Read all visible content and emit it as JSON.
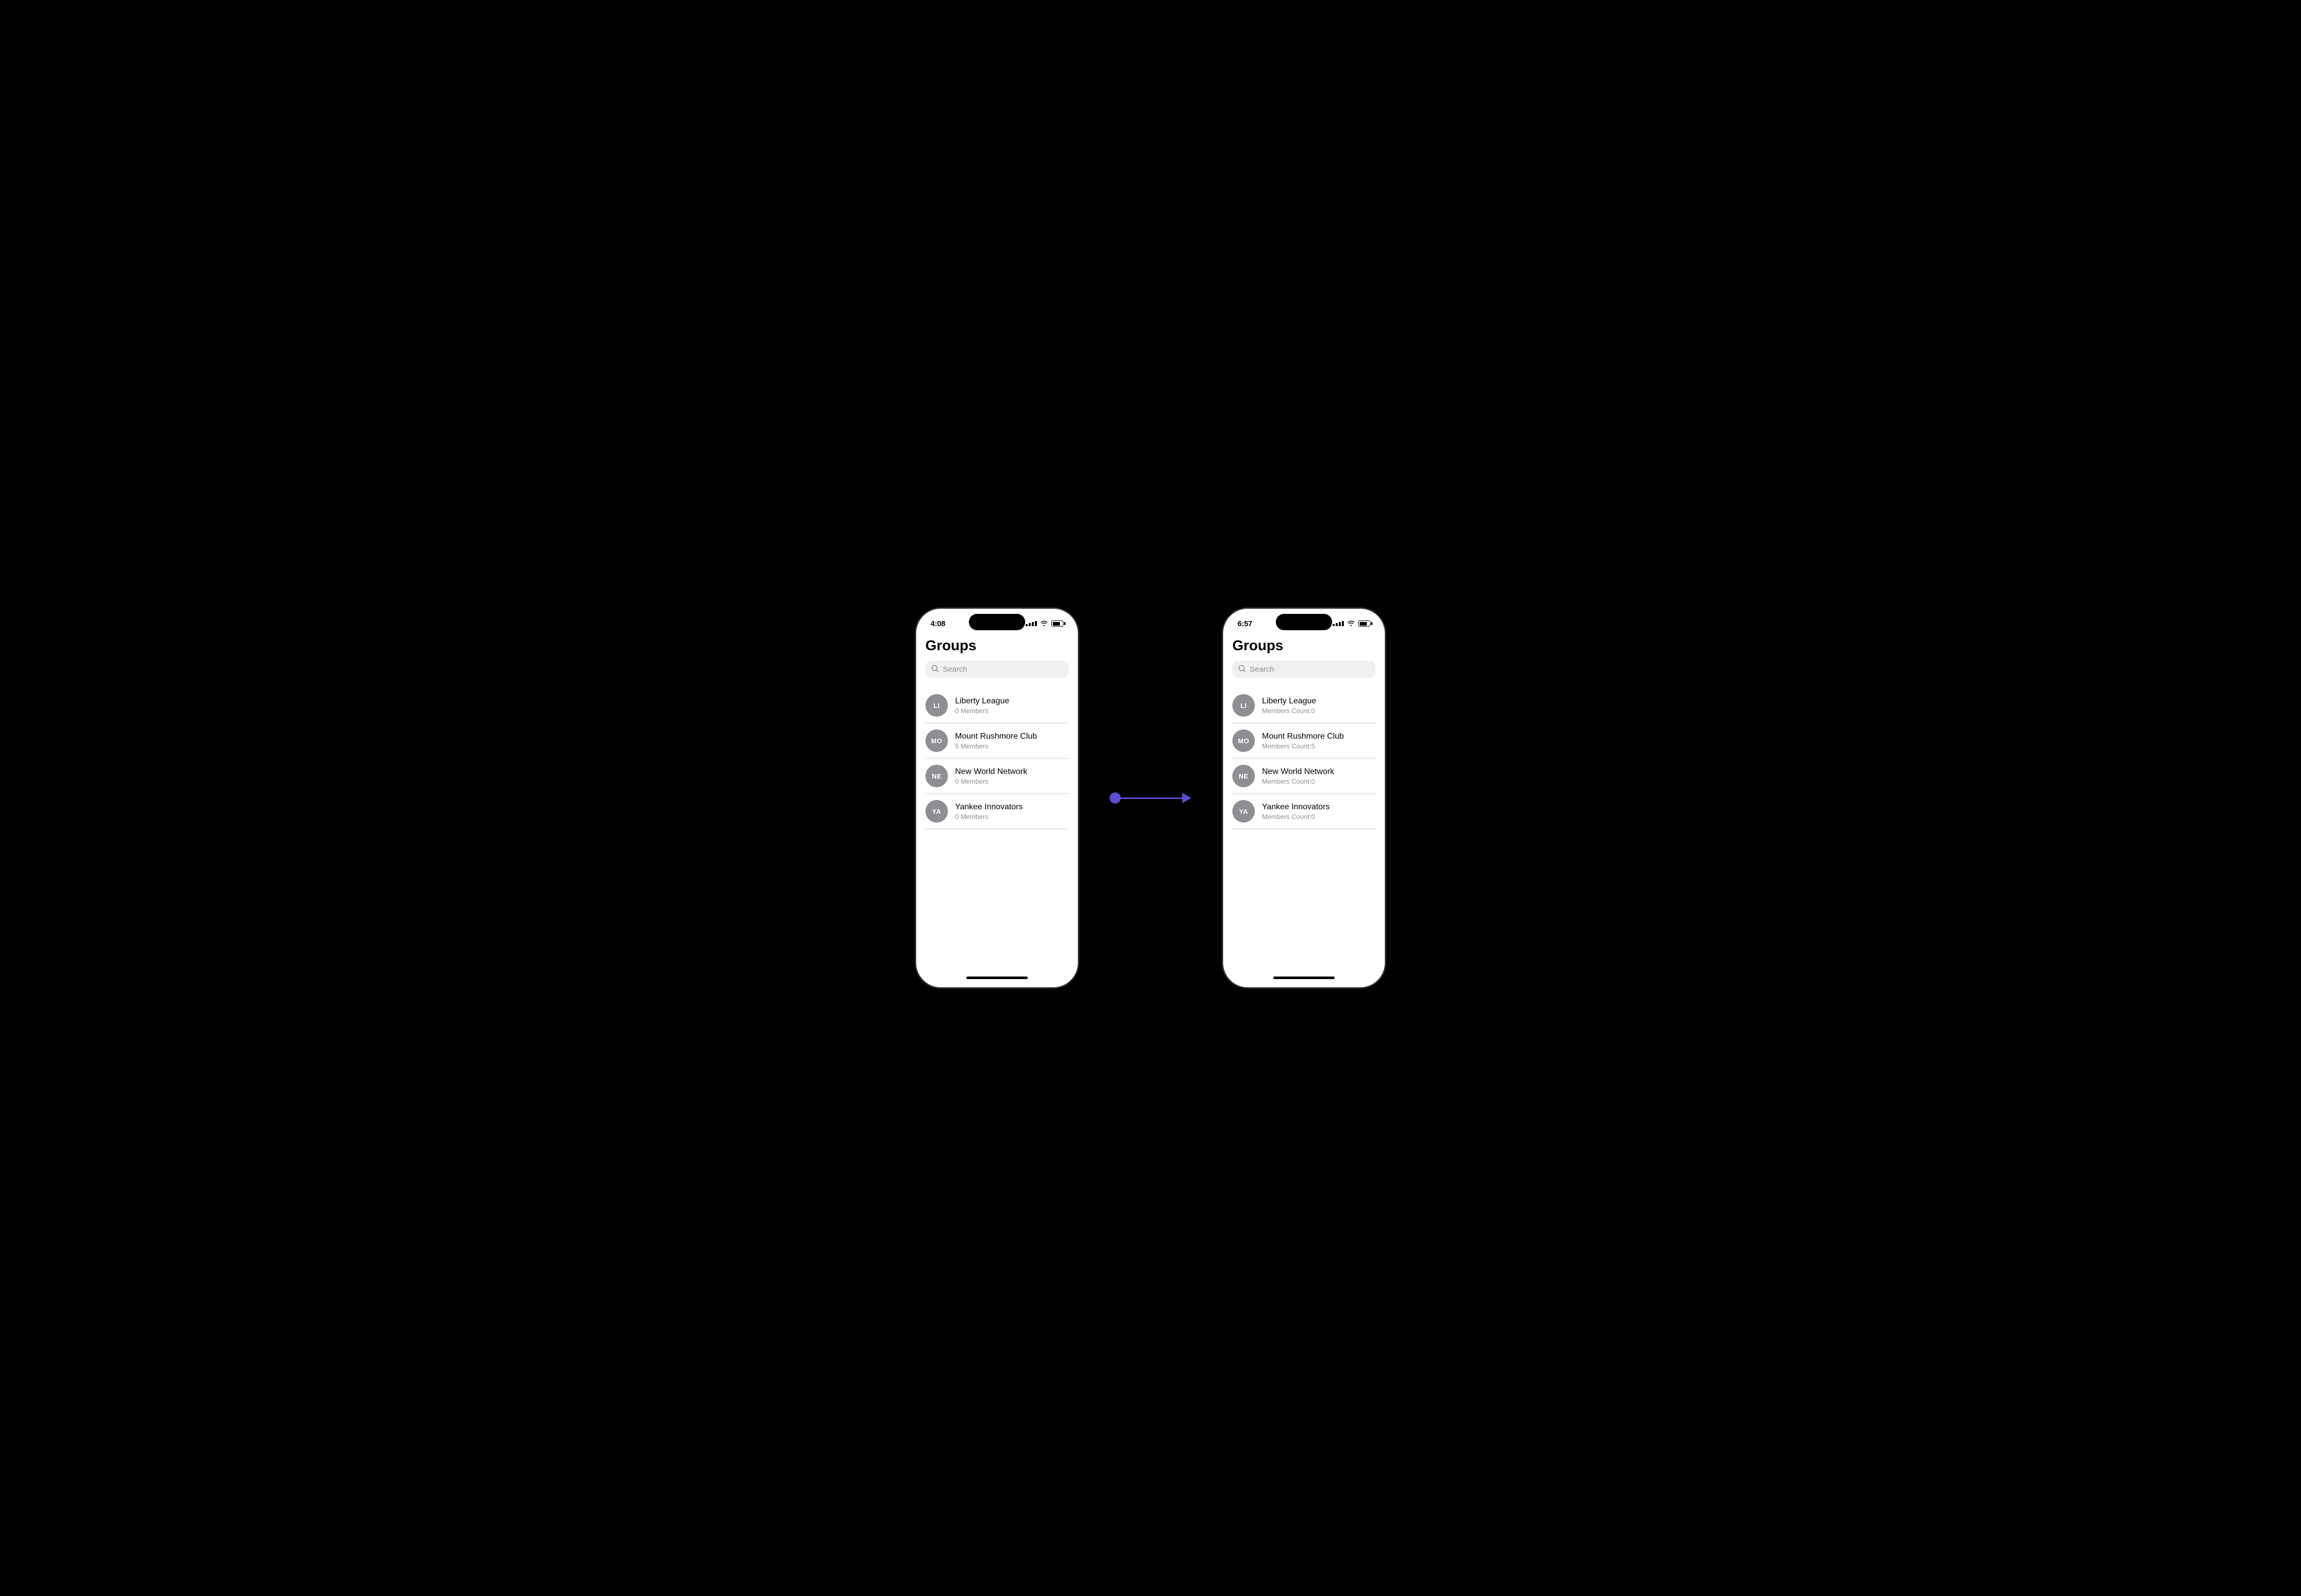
{
  "leftPhone": {
    "time": "4:08",
    "title": "Groups",
    "search": {
      "placeholder": "Search"
    },
    "groups": [
      {
        "initials": "LI",
        "name": "Liberty League",
        "members": "0 Members"
      },
      {
        "initials": "MO",
        "name": "Mount Rushmore Club",
        "members": "5 Members"
      },
      {
        "initials": "NE",
        "name": "New World Network",
        "members": "0 Members"
      },
      {
        "initials": "YA",
        "name": "Yankee Innovators",
        "members": "0 Members"
      }
    ]
  },
  "rightPhone": {
    "time": "6:57",
    "title": "Groups",
    "search": {
      "placeholder": "Search"
    },
    "groups": [
      {
        "initials": "LI",
        "name": "Liberty League",
        "members": "Members Count:0"
      },
      {
        "initials": "MO",
        "name": "Mount Rushmore Club",
        "members": "Members Count:5"
      },
      {
        "initials": "NE",
        "name": "New World Network",
        "members": "Members Count:0"
      },
      {
        "initials": "YA",
        "name": "Yankee Innovators",
        "members": "Members Count:0"
      }
    ]
  },
  "arrow": {
    "color": "#5a4fcf"
  }
}
